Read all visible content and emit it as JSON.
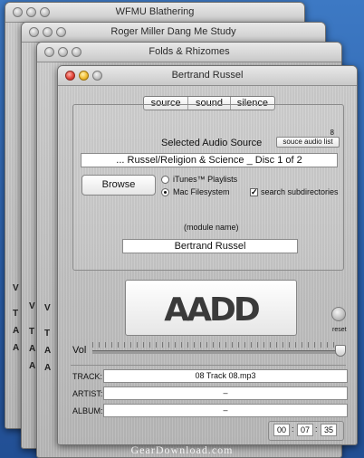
{
  "background_windows": [
    {
      "title": "WFMU Blathering"
    },
    {
      "title": "Roger Miller Dang Me Study"
    },
    {
      "title": "Folds & Rhizomes"
    }
  ],
  "stub_labels": {
    "vol": "V",
    "track": "T",
    "artist": "A",
    "album": "A"
  },
  "main_window": {
    "title": "Bertrand Russel",
    "tabs": [
      "source",
      "sound",
      "silence"
    ],
    "source_panel": {
      "counter": "8",
      "heading": "Selected Audio Source",
      "source_list_button": "souce audio list",
      "source_field": "... Russel/Religion & Science _ Disc 1 of 2",
      "browse_button": "Browse",
      "radio_itunes": "iTunes™ Playlists",
      "radio_mac": "Mac Filesystem",
      "radio_selected": "Mac Filesystem",
      "checkbox_label": "search subdirectories",
      "checkbox_checked": true,
      "module_name_label": "(module name)",
      "module_name_value": "Bertrand Russel"
    },
    "logo_text": "AADD",
    "reset_label": "reset",
    "vol_label": "Vol",
    "track": {
      "label": "TRACK:",
      "value": "08 Track 08.mp3"
    },
    "artist": {
      "label": "ARTIST:",
      "value": "–"
    },
    "album": {
      "label": "ALBUM:",
      "value": "–"
    },
    "time": {
      "h": "00",
      "m": "07",
      "s": "35"
    }
  },
  "watermark": "GearDownload.com"
}
